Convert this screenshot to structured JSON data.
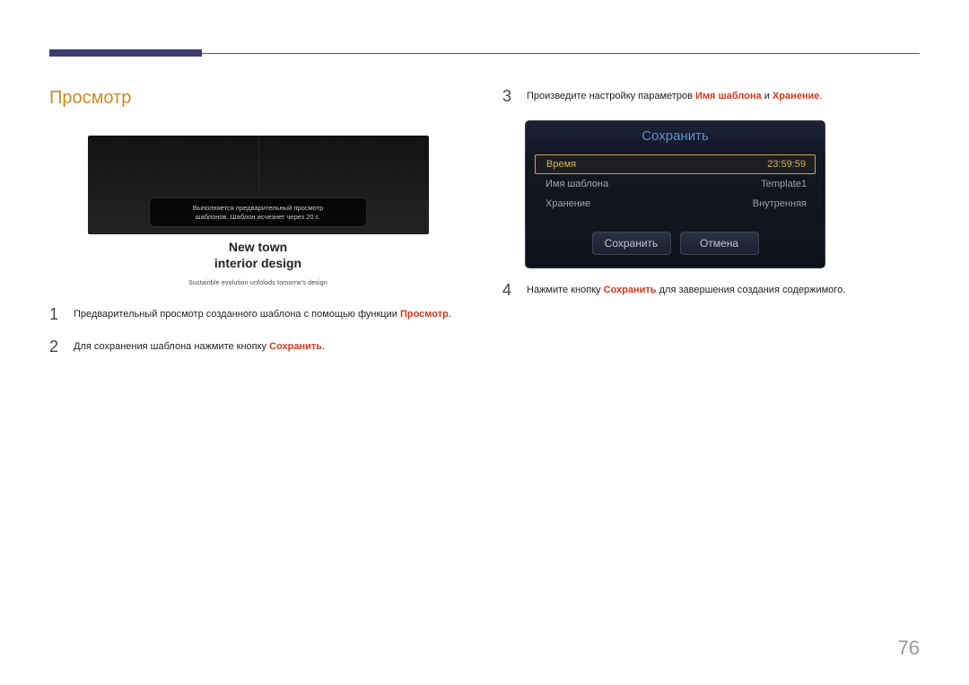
{
  "section_title": "Просмотр",
  "preview": {
    "overlay_line1": "Выполняется предварительный просмотр",
    "overlay_line2": "шаблонов. Шаблон исчезнет через 20 с.",
    "caption_line1": "New town",
    "caption_line2": "interior design",
    "subcaption": "Sustainble evolution unfolods tomorrw's design"
  },
  "steps_left": [
    {
      "num": "1",
      "pre": "Предварительный просмотр созданного шаблона с помощью функции ",
      "kw": "Просмотр",
      "post": "."
    },
    {
      "num": "2",
      "pre": "Для сохранения шаблона нажмите кнопку ",
      "kw": "Сохранить",
      "post": "."
    }
  ],
  "steps_right": [
    {
      "num": "3",
      "pre": "Произведите настройку параметров ",
      "kw": "Имя шаблона",
      "mid": " и ",
      "kw2": "Хранение",
      "post": "."
    },
    {
      "num": "4",
      "pre": "Нажмите кнопку ",
      "kw": "Сохранить",
      "post": " для завершения создания содержимого."
    }
  ],
  "dialog": {
    "title": "Сохранить",
    "rows": [
      {
        "label": "Время",
        "value": "23:59:59",
        "selected": true
      },
      {
        "label": "Имя шаблона",
        "value": "Template1",
        "selected": false
      },
      {
        "label": "Хранение",
        "value": "Внутренняя",
        "selected": false
      }
    ],
    "btn_save": "Сохранить",
    "btn_cancel": "Отмена"
  },
  "page_number": "76"
}
